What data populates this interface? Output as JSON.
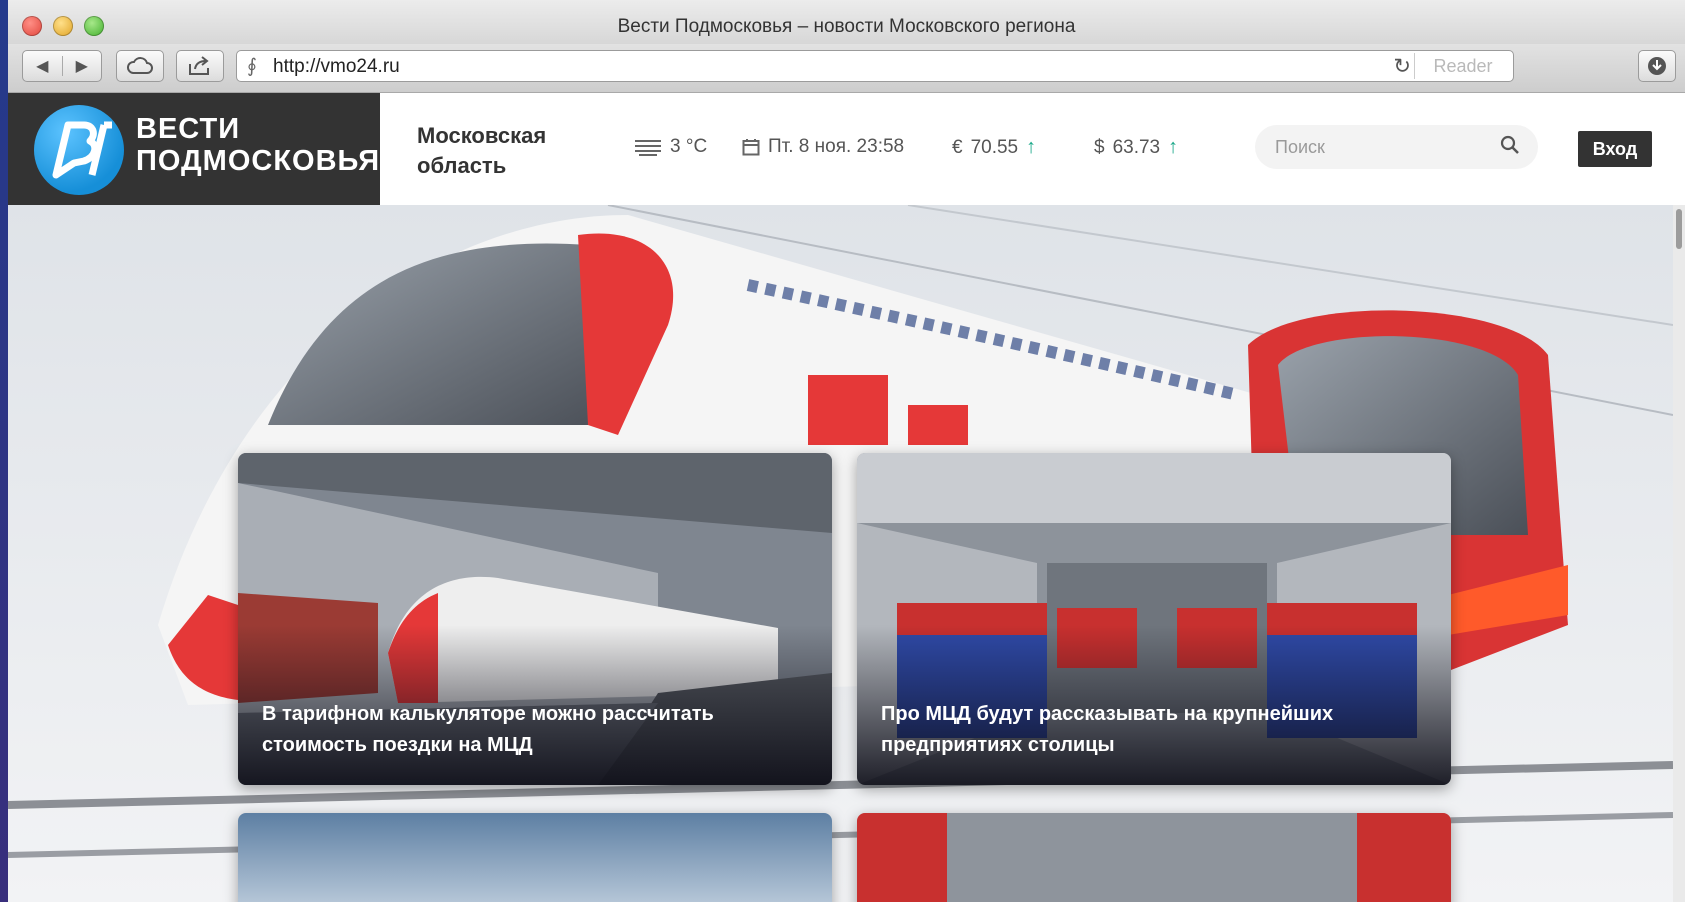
{
  "window": {
    "title": "Вести Подмосковья – новости Московского региона",
    "url": "http://vmo24.ru",
    "reader_label": "Reader"
  },
  "site": {
    "brand_line1": "ВЕСТИ",
    "brand_line2": "ПОДМОСКОВЬЯ",
    "region": "Московская область",
    "weather": {
      "icon": "fog-icon",
      "temp": "3 °C"
    },
    "date": {
      "icon": "calendar-icon",
      "text": "Пт. 8 ноя. 23:58"
    },
    "currency": [
      {
        "symbol": "€",
        "value": "70.55",
        "trend": "up"
      },
      {
        "symbol": "$",
        "value": "63.73",
        "trend": "up"
      }
    ],
    "search_placeholder": "Поиск",
    "login_label": "Вход"
  },
  "news": [
    {
      "headline": "В тарифном калькуляторе можно рассчитать стоимость поездки на МЦД"
    },
    {
      "headline": "Про МЦД будут рассказывать на крупнейших предприятиях столицы"
    }
  ],
  "colors": {
    "brand_dark": "#333333",
    "logo_blue": "#168fd8",
    "trend_up": "#1aa889",
    "train_red": "#e53838"
  }
}
